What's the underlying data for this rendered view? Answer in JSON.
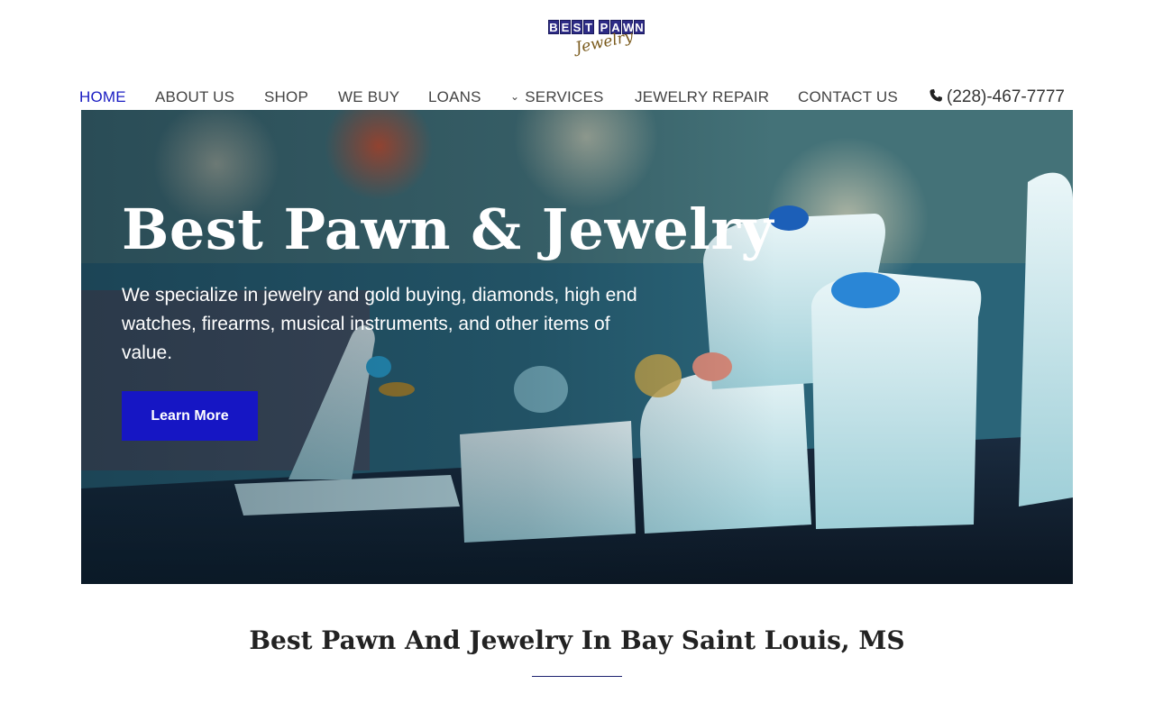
{
  "logo": {
    "word1": [
      "B",
      "E",
      "S",
      "T"
    ],
    "word2": [
      "P",
      "A",
      "W",
      "N"
    ],
    "script": "Jewelry"
  },
  "nav": {
    "items": [
      {
        "label": "HOME",
        "active": true
      },
      {
        "label": "ABOUT US"
      },
      {
        "label": "SHOP"
      },
      {
        "label": "WE BUY"
      },
      {
        "label": "LOANS"
      },
      {
        "label": "SERVICES",
        "has_dropdown": true,
        "icon": "chevron-down-icon"
      },
      {
        "label": "JEWELRY REPAIR"
      },
      {
        "label": "CONTACT US"
      }
    ],
    "phone": {
      "icon": "phone-icon",
      "number": "(228)-467-7777"
    }
  },
  "hero": {
    "title_regular": "Best Pawn & ",
    "title_bold": "Jewelry",
    "description": "We specialize in jewelry and gold buying, diamonds, high end watches, firearms, musical instruments, and other items of value.",
    "button_label": "Learn More"
  },
  "section": {
    "title": "Best Pawn And Jewelry In Bay Saint Louis, MS"
  },
  "colors": {
    "accent": "#1a1cc2",
    "button": "#1616c4",
    "rule": "#1c2170"
  }
}
